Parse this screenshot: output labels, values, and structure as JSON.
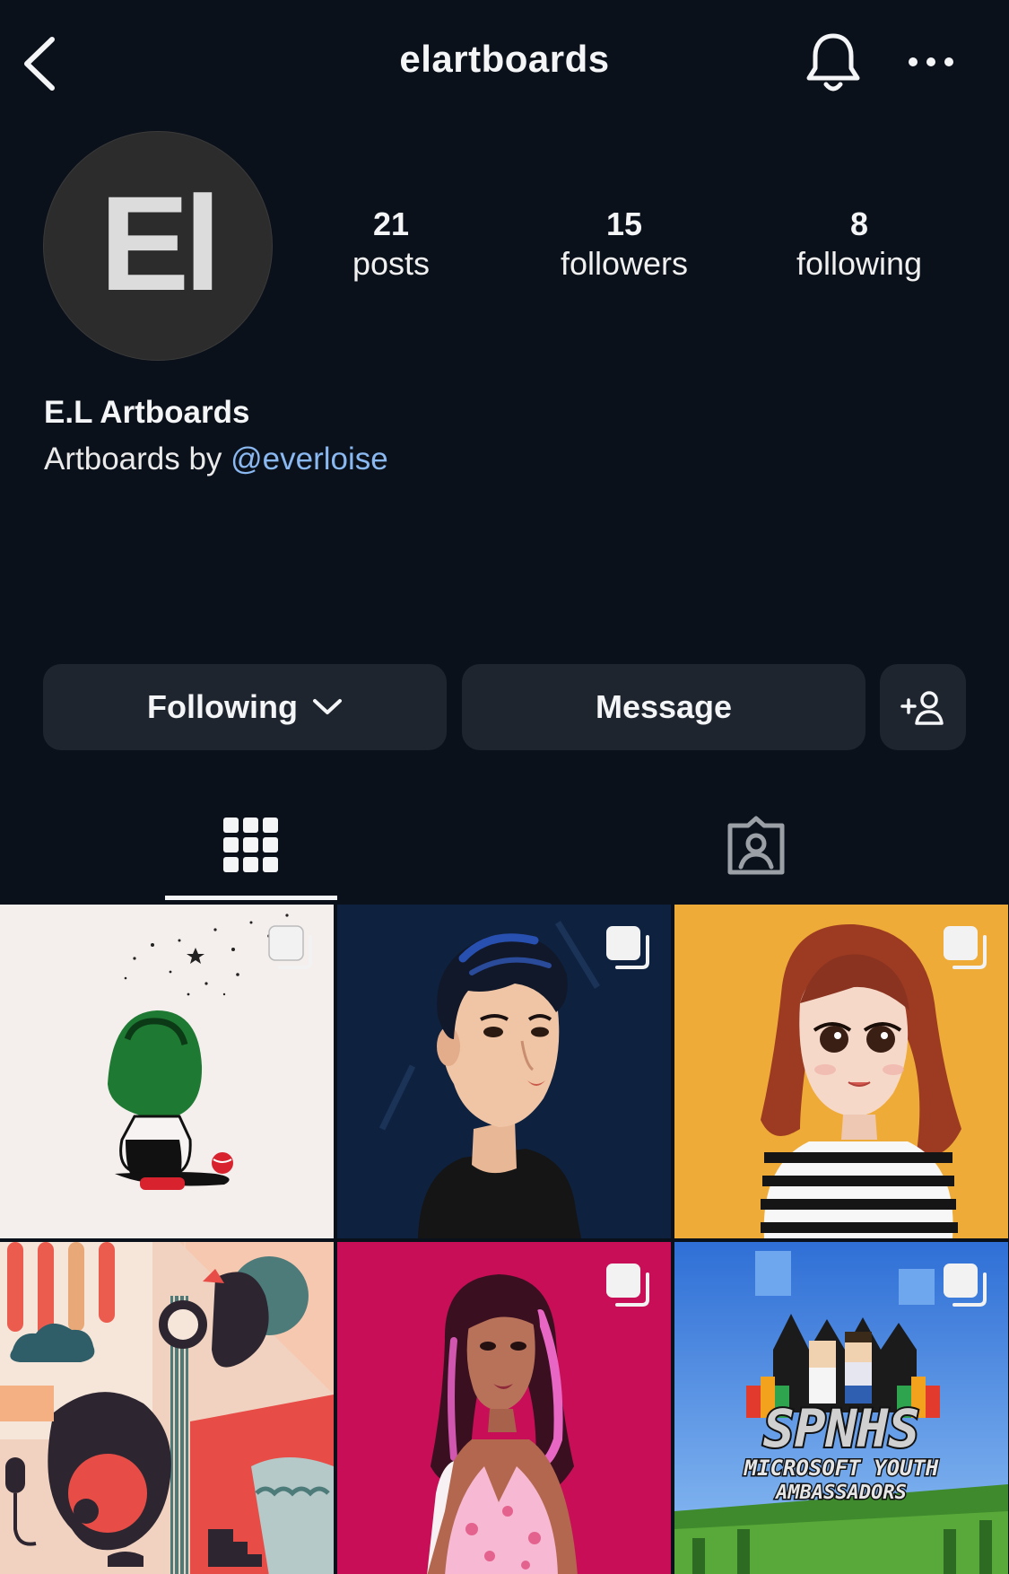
{
  "header": {
    "username": "elartboards"
  },
  "profile": {
    "avatar_initials": "El",
    "display_name": "E.L Artboards",
    "bio_prefix": "Artboards by ",
    "bio_mention": "@everloise"
  },
  "stats": {
    "posts": {
      "value": "21",
      "label": "posts"
    },
    "followers": {
      "value": "15",
      "label": "followers"
    },
    "following": {
      "value": "8",
      "label": "following"
    }
  },
  "actions": {
    "following_label": "Following",
    "message_label": "Message"
  },
  "tabs": [
    {
      "icon": "grid-icon",
      "active": true
    },
    {
      "icon": "tagged-icon",
      "active": false
    }
  ],
  "grid": {
    "posts": [
      {
        "icon": "multiple-images-icon",
        "bg": "#f4eeec",
        "art": "child-green-helmet"
      },
      {
        "icon": "multiple-images-icon",
        "bg": "#0e2240",
        "art": "man-portrait"
      },
      {
        "icon": "multiple-images-icon",
        "bg": "#efab38",
        "art": "girl-striped-shirt"
      },
      {
        "icon": null,
        "bg": "#f1d2c0",
        "art": "music-poster"
      },
      {
        "icon": "multiple-images-icon",
        "bg": "#c70e57",
        "art": "woman-portrait"
      },
      {
        "icon": "multiple-images-icon",
        "bg": "#4a8fe0",
        "art": "minecraft-banner"
      }
    ],
    "tile6_text": {
      "line1": "SPNHS",
      "line2": "MICROSOFT YOUTH",
      "line3": "AMBASSADORS"
    }
  },
  "colors": {
    "background": "#0b111a",
    "button": "#1f252e",
    "mention": "#8ab8f0",
    "avatar": "#2c2c2c"
  }
}
